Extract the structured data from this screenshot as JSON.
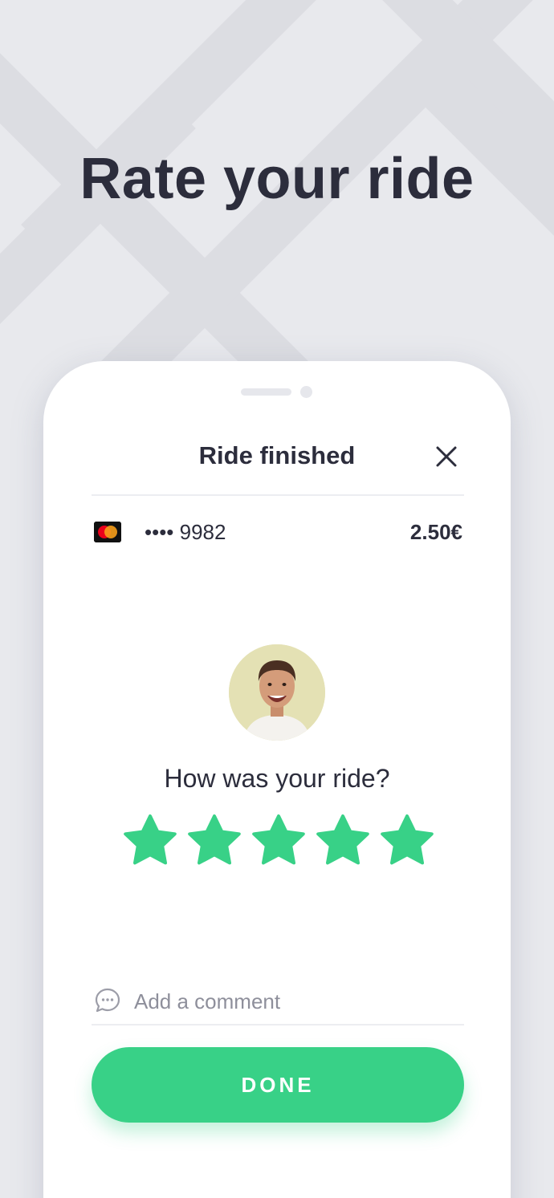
{
  "headline": "Rate your ride",
  "sheet": {
    "title": "Ride finished",
    "close_icon": "close-icon"
  },
  "payment": {
    "card_icon": "mastercard-icon",
    "card_number": "•••• 9982",
    "price": "2.50€"
  },
  "driver": {
    "avatar_icon": "driver-avatar"
  },
  "rating": {
    "question": "How was your ride?",
    "value": 5,
    "max": 5,
    "star_color": "#38d187"
  },
  "comment": {
    "placeholder": "Add a comment",
    "icon": "chat-bubble-icon"
  },
  "done_button": {
    "label": "DONE",
    "color": "#38d187"
  }
}
